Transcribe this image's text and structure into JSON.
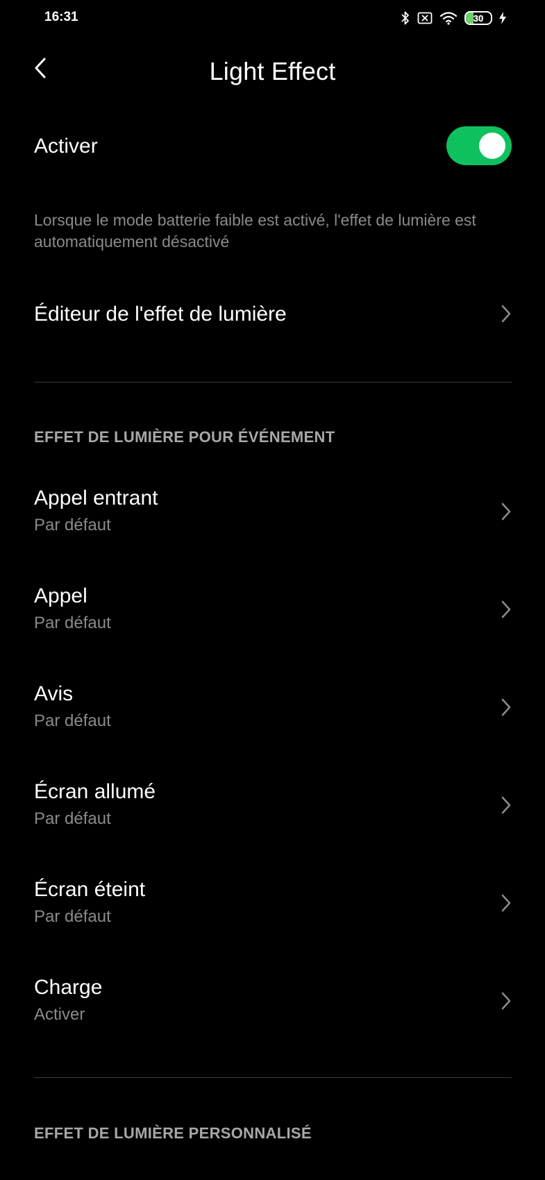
{
  "status_bar": {
    "time": "16:31",
    "icons": [
      "bluetooth-icon",
      "no-sim-icon",
      "wifi-icon",
      "battery-icon",
      "charging-bolt-icon"
    ],
    "battery_level": "30",
    "battery_fraction": 0.3,
    "battery_color": "#6cd16b"
  },
  "header": {
    "back_icon": "chevron-left-icon",
    "title": "Light Effect"
  },
  "enable": {
    "label": "Activer",
    "on": true,
    "accent_color": "#0ec15e"
  },
  "note": "Lorsque le mode batterie faible est activé, l'effet de lumière est automatiquement désactivé",
  "editor": {
    "label": "Éditeur de l'effet de lumière"
  },
  "events_section": {
    "header": "EFFET DE LUMIÈRE POUR ÉVÉNEMENT",
    "items": [
      {
        "title": "Appel entrant",
        "value": "Par défaut"
      },
      {
        "title": "Appel",
        "value": "Par défaut"
      },
      {
        "title": "Avis",
        "value": "Par défaut"
      },
      {
        "title": "Écran allumé",
        "value": "Par défaut"
      },
      {
        "title": "Écran éteint",
        "value": "Par défaut"
      },
      {
        "title": "Charge",
        "value": "Activer"
      }
    ]
  },
  "custom_section": {
    "header": "EFFET DE LUMIÈRE PERSONNALISÉ"
  }
}
